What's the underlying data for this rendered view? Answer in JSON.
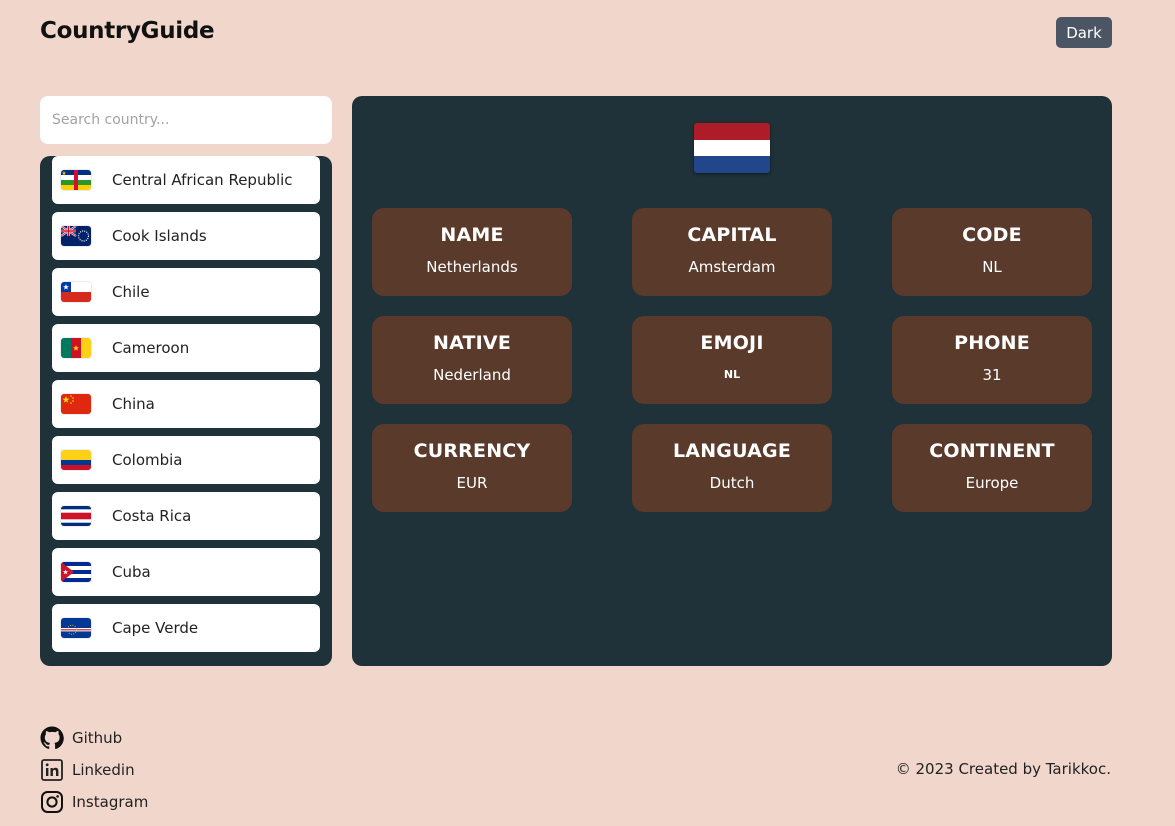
{
  "header": {
    "brand": "CountryGuide",
    "theme_button": "Dark"
  },
  "search": {
    "placeholder": "Search country...",
    "value": ""
  },
  "country_list": [
    {
      "name": "Central African Republic",
      "flag": "cf"
    },
    {
      "name": "Cook Islands",
      "flag": "ck"
    },
    {
      "name": "Chile",
      "flag": "cl"
    },
    {
      "name": "Cameroon",
      "flag": "cm"
    },
    {
      "name": "China",
      "flag": "cn"
    },
    {
      "name": "Colombia",
      "flag": "co"
    },
    {
      "name": "Costa Rica",
      "flag": "cr"
    },
    {
      "name": "Cuba",
      "flag": "cu"
    },
    {
      "name": "Cape Verde",
      "flag": "cv"
    }
  ],
  "selected_country": {
    "flag": "nl",
    "flag_colors": [
      "#ae1c28",
      "#ffffff",
      "#21468b"
    ],
    "fields": [
      {
        "title": "NAME",
        "value": "Netherlands"
      },
      {
        "title": "CAPITAL",
        "value": "Amsterdam"
      },
      {
        "title": "CODE",
        "value": "NL"
      },
      {
        "title": "NATIVE",
        "value": "Nederland"
      },
      {
        "title": "EMOJI",
        "value": "NL"
      },
      {
        "title": "PHONE",
        "value": "31"
      },
      {
        "title": "CURRENCY",
        "value": "EUR"
      },
      {
        "title": "LANGUAGE",
        "value": "Dutch"
      },
      {
        "title": "CONTINENT",
        "value": "Europe"
      }
    ]
  },
  "footer": {
    "links": [
      {
        "label": "Github",
        "icon": "github-icon"
      },
      {
        "label": "Linkedin",
        "icon": "linkedin-icon"
      },
      {
        "label": "Instagram",
        "icon": "instagram-icon"
      }
    ],
    "copyright": "© 2023 Created by Tarikkoc."
  },
  "colors": {
    "background": "#f1d7cb",
    "panel": "#1f3239",
    "card": "#593a2b",
    "button": "#4b5563"
  }
}
